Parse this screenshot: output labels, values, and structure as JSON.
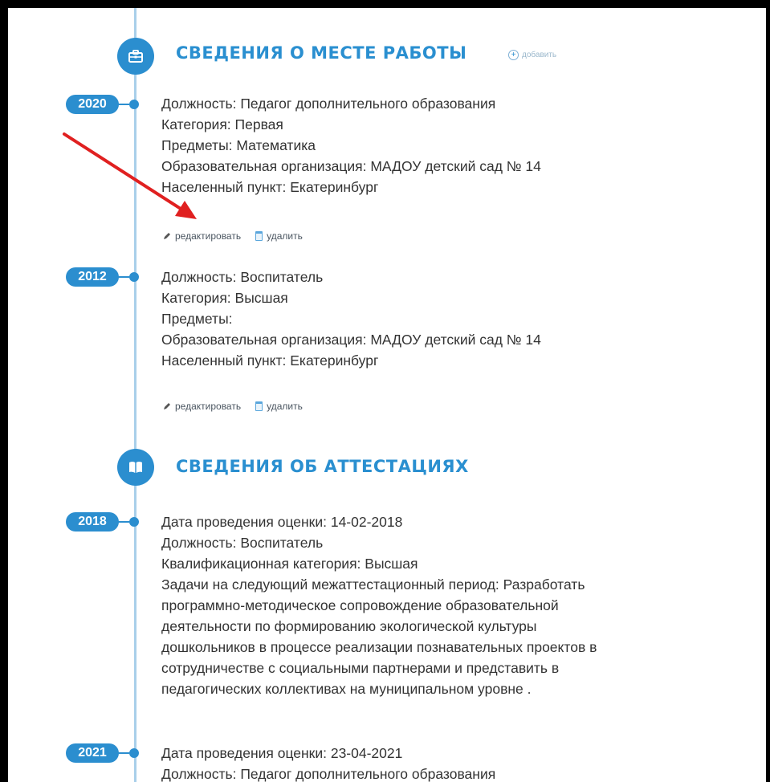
{
  "sections": [
    {
      "title": "СВЕДЕНИЯ О МЕСТЕ РАБОТЫ",
      "icon": "briefcase-icon",
      "add_label": "добавить"
    },
    {
      "title": "СВЕДЕНИЯ ОБ АТТЕСТАЦИЯХ",
      "icon": "book-icon"
    }
  ],
  "work_entries": [
    {
      "year": "2020",
      "lines": [
        "Должность: Педагог дополнительного образования",
        "Категория: Первая",
        "Предметы: Математика",
        "Образовательная организация: МАДОУ детский сад № 14",
        "Населенный пункт: Екатеринбург"
      ],
      "edit_label": "редактировать",
      "delete_label": "удалить"
    },
    {
      "year": "2012",
      "lines": [
        "Должность: Воспитатель",
        "Категория: Высшая",
        "Предметы:",
        "Образовательная организация: МАДОУ детский сад № 14",
        "Населенный пункт: Екатеринбург"
      ],
      "edit_label": "редактировать",
      "delete_label": "удалить"
    }
  ],
  "attestation_entries": [
    {
      "year": "2018",
      "lines": [
        "Дата проведения оценки: 14-02-2018",
        "Должность: Воспитатель",
        "Квалификационная категория: Высшая"
      ],
      "tasks": [
        "Задачи на следующий межаттестационный период: Разработать",
        "программно-методическое сопровождение образовательной",
        "деятельности по формированию экологической культуры",
        "дошкольников в процессе реализации познавательных проектов в",
        "сотрудничестве с социальными партнерами и представить в",
        "педагогических коллективах на муниципальном уровне ."
      ]
    },
    {
      "year": "2021",
      "lines": [
        "Дата проведения оценки: 23-04-2021",
        "Должность: Педагог дополнительного образования"
      ]
    }
  ],
  "colors": {
    "accent": "#2b8ecf",
    "timeline": "#a9cfea",
    "arrow": "#e02020"
  }
}
